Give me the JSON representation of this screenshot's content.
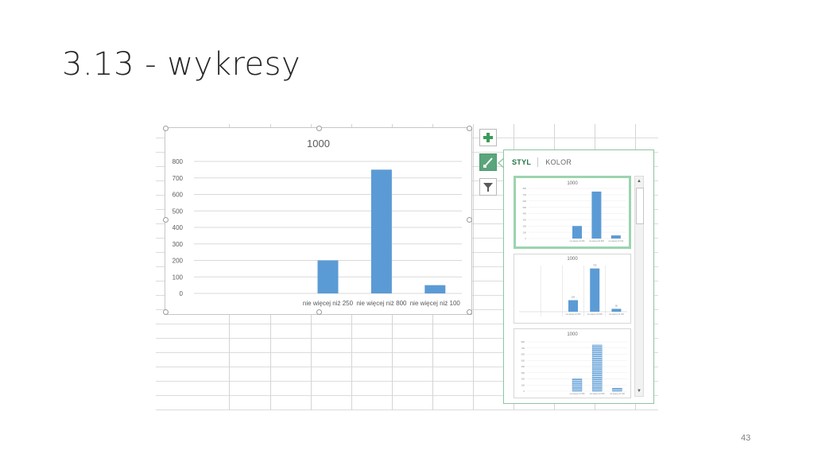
{
  "slide": {
    "title": "3.13 - wykresy",
    "page_number": "43"
  },
  "chart_data": {
    "type": "bar",
    "title": "1000",
    "categories": [
      "",
      "",
      "nie więcej niż 250",
      "nie więcej niż 800",
      "nie więcej niż 100"
    ],
    "values": [
      0,
      0,
      200,
      750,
      50
    ],
    "ylim": [
      0,
      800
    ],
    "yticks": [
      0,
      100,
      200,
      300,
      400,
      500,
      600,
      700,
      800
    ],
    "grid": true,
    "color": "#5b9bd5"
  },
  "chart_tools": {
    "add_element_icon": "plus-icon",
    "style_icon": "brush-icon",
    "filter_icon": "filter-icon"
  },
  "style_pane": {
    "tabs": [
      {
        "label": "STYL",
        "selected": true
      },
      {
        "label": "KOLOR",
        "selected": false
      }
    ],
    "thumbnails": [
      {
        "title": "1000",
        "variant": "solid-gridlines"
      },
      {
        "title": "1000",
        "variant": "labels-columns"
      },
      {
        "title": "1000",
        "variant": "striped"
      }
    ],
    "scroll_up_icon": "triangle-up-icon",
    "scroll_down_icon": "triangle-down-icon"
  },
  "colors": {
    "bar": "#5b9bd5",
    "accent_green": "#217346",
    "selection_green": "#9bd4ae"
  }
}
